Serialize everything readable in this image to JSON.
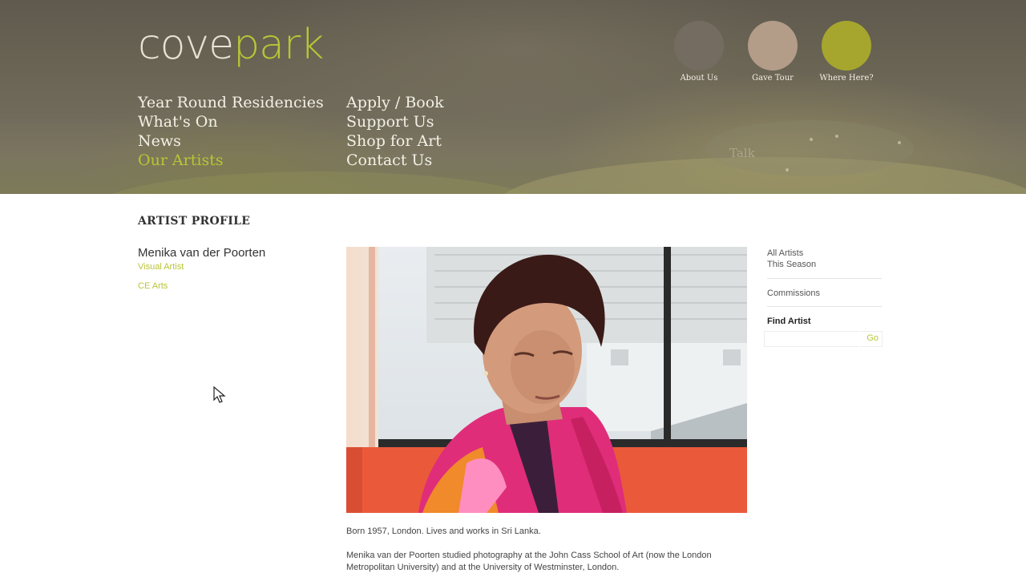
{
  "brand": {
    "logo_left": "cove",
    "logo_right": "park",
    "accent_color": "#b9c535"
  },
  "nav": {
    "col1": [
      "Year Round Residencies",
      "What's On",
      "News",
      "Our Artists"
    ],
    "col2": [
      "Apply / Book",
      "Support Us",
      "Shop for Art",
      "Contact Us"
    ],
    "active": "Our Artists"
  },
  "quick_links": [
    {
      "label": "About Us",
      "color": "#756c61"
    },
    {
      "label": "Gave Tour",
      "color": "#b39c88"
    },
    {
      "label": "Where Here?",
      "color": "#a6a62e"
    }
  ],
  "header_faint_text": "Talk",
  "page": {
    "heading": "ARTIST PROFILE",
    "artist_name": "Menika van der Poorten",
    "artist_role": "Visual Artist",
    "artist_link": "CE Arts"
  },
  "photo": {
    "subject": "portrait-of-artist"
  },
  "bio": {
    "p1": "Born 1957, London. Lives and works in Sri Lanka.",
    "p2": "Menika van der Poorten studied photography at the John Cass School of Art (now the London Metropolitan University) and at the University of Westminster, London."
  },
  "sidebar": {
    "links1": [
      "All Artists",
      "This Season"
    ],
    "links2": [
      "Commissions"
    ],
    "find_title": "Find Artist",
    "find_placeholder": "",
    "find_go": "Go"
  }
}
